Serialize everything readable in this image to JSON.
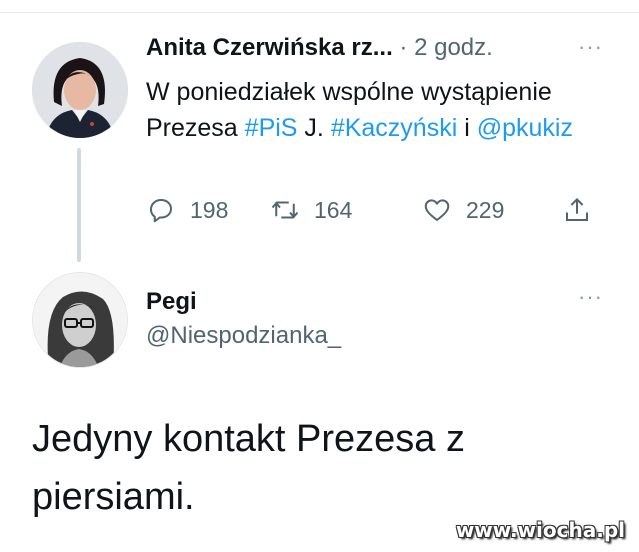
{
  "tweet1": {
    "author_name": "Anita Czerwińska rz...",
    "time": "· 2 godz.",
    "text_parts": [
      {
        "text": "W poniedziałek wspólne wystąpienie Prezesa ",
        "link": false
      },
      {
        "text": "#PiS",
        "link": true
      },
      {
        "text": " J. ",
        "link": false
      },
      {
        "text": "#Kaczyński",
        "link": true
      },
      {
        "text": " i ",
        "link": false
      },
      {
        "text": "@pkukiz",
        "link": true
      }
    ],
    "reply_count": "198",
    "retweet_count": "164",
    "like_count": "229"
  },
  "tweet2": {
    "author_name": "Pegi",
    "handle": "@Niespodzianka_",
    "text": "Jedyny kontakt Prezesa z piersiami."
  },
  "more_label": "···",
  "watermark": "www.wiocha.pl",
  "colors": {
    "link": "#1d9bf0",
    "muted": "#536471",
    "thread_line": "#cfd9de"
  }
}
